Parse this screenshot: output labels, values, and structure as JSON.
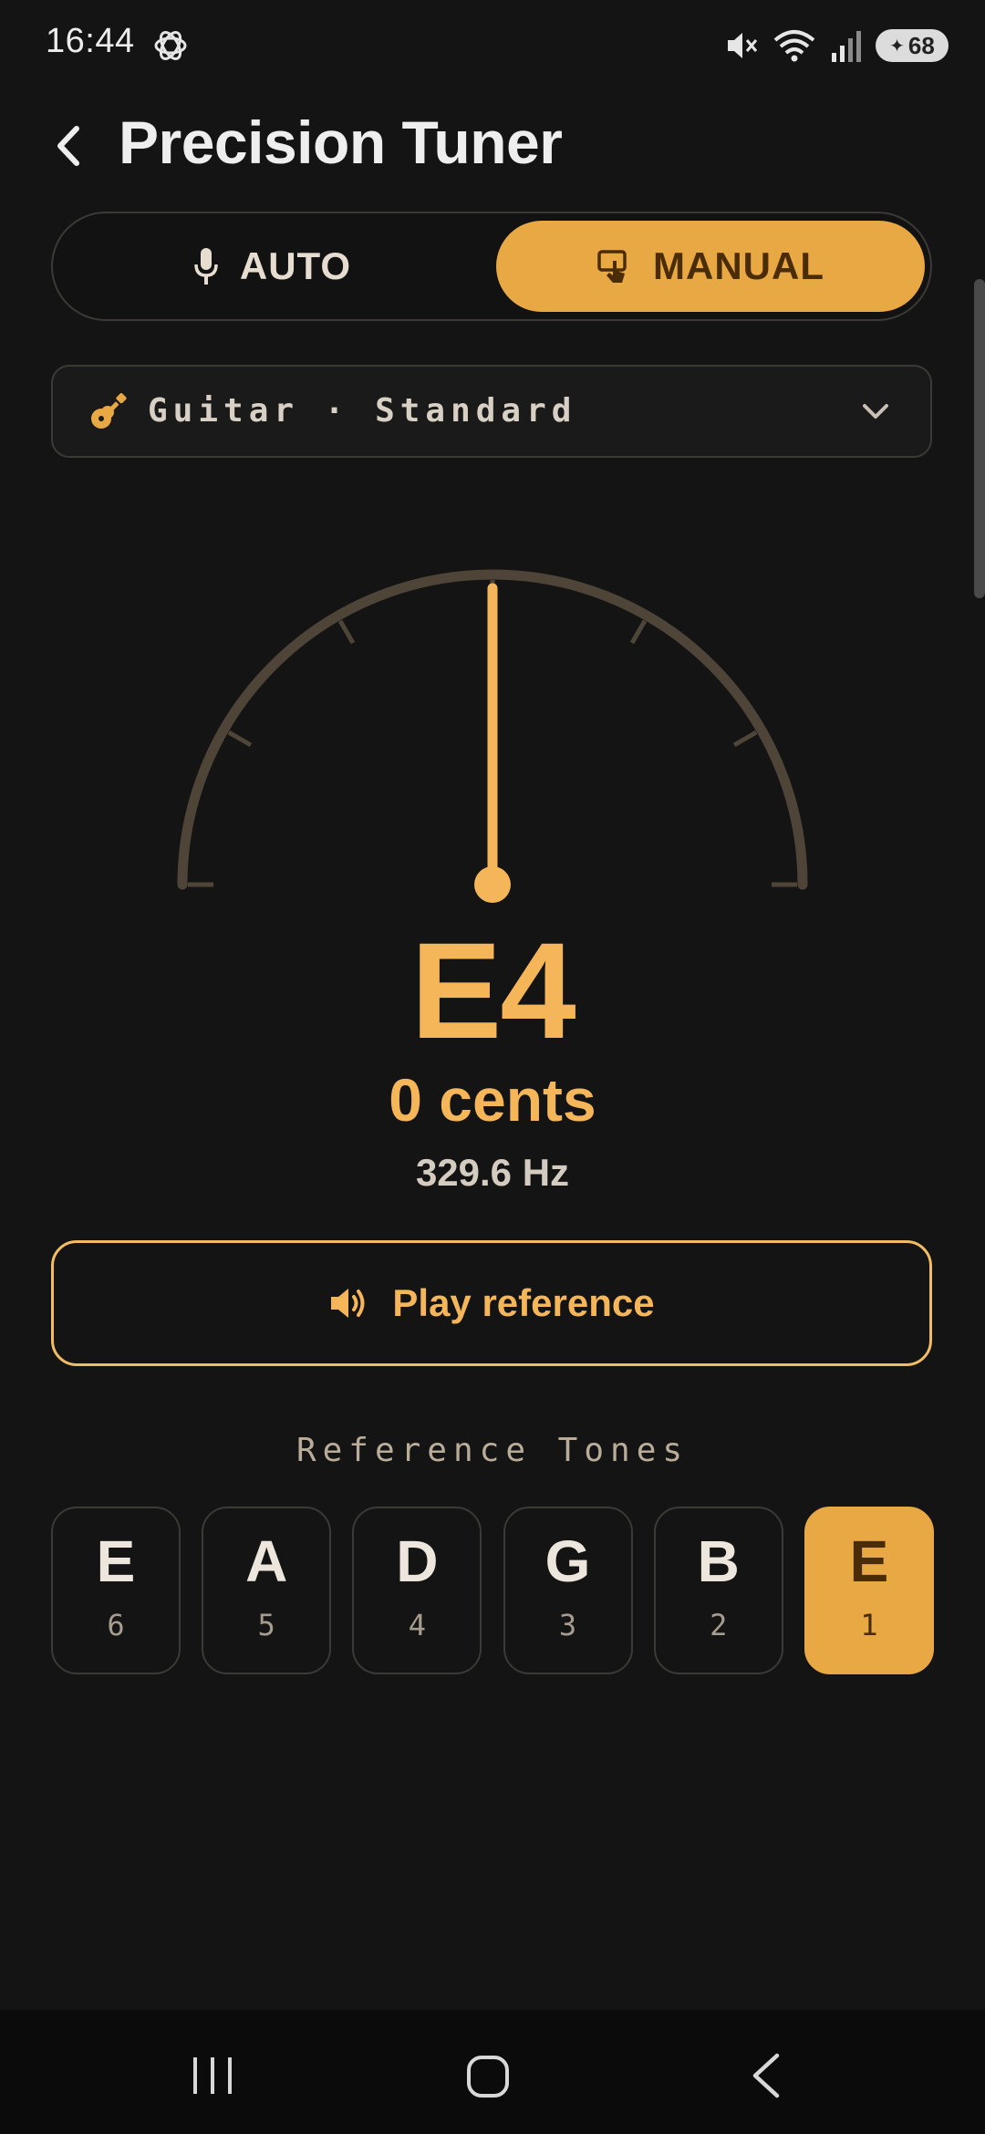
{
  "status_bar": {
    "time": "16:44",
    "battery": "68",
    "icons": [
      "openai-icon",
      "mute-icon",
      "wifi-icon",
      "signal-icon",
      "battery-icon"
    ]
  },
  "header": {
    "title": "Precision Tuner",
    "back_icon": "chevron-left-icon"
  },
  "mode_toggle": {
    "auto_label": "AUTO",
    "manual_label": "MANUAL",
    "selected": "MANUAL"
  },
  "instrument": {
    "label": "Guitar · Standard",
    "icon": "guitar-icon"
  },
  "gauge": {
    "cents": 0,
    "range_cents": [
      -50,
      50
    ]
  },
  "readout": {
    "note": "E4",
    "cents_text": "0 cents",
    "frequency_text": "329.6 Hz"
  },
  "play_button": {
    "label": "Play reference",
    "icon": "speaker-icon"
  },
  "reference_tones": {
    "title": "Reference Tones",
    "tones": [
      {
        "note": "E",
        "string": "6"
      },
      {
        "note": "A",
        "string": "5"
      },
      {
        "note": "D",
        "string": "4"
      },
      {
        "note": "G",
        "string": "3"
      },
      {
        "note": "B",
        "string": "2"
      },
      {
        "note": "E",
        "string": "1"
      }
    ],
    "active_index": 5
  },
  "colors": {
    "accent": "#e8a843",
    "accent_text": "#f5b65a",
    "background": "#141414",
    "gauge_track": "#4e4538"
  }
}
